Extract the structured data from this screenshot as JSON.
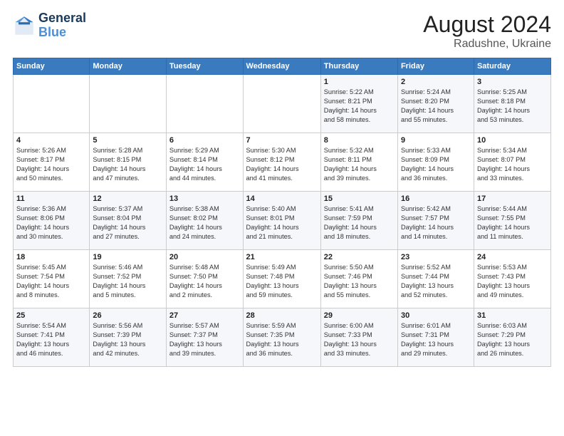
{
  "logo": {
    "line1": "General",
    "line2": "Blue"
  },
  "title": "August 2024",
  "location": "Radushne, Ukraine",
  "days_header": [
    "Sunday",
    "Monday",
    "Tuesday",
    "Wednesday",
    "Thursday",
    "Friday",
    "Saturday"
  ],
  "weeks": [
    [
      {
        "day": "",
        "info": ""
      },
      {
        "day": "",
        "info": ""
      },
      {
        "day": "",
        "info": ""
      },
      {
        "day": "",
        "info": ""
      },
      {
        "day": "1",
        "info": "Sunrise: 5:22 AM\nSunset: 8:21 PM\nDaylight: 14 hours\nand 58 minutes."
      },
      {
        "day": "2",
        "info": "Sunrise: 5:24 AM\nSunset: 8:20 PM\nDaylight: 14 hours\nand 55 minutes."
      },
      {
        "day": "3",
        "info": "Sunrise: 5:25 AM\nSunset: 8:18 PM\nDaylight: 14 hours\nand 53 minutes."
      }
    ],
    [
      {
        "day": "4",
        "info": "Sunrise: 5:26 AM\nSunset: 8:17 PM\nDaylight: 14 hours\nand 50 minutes."
      },
      {
        "day": "5",
        "info": "Sunrise: 5:28 AM\nSunset: 8:15 PM\nDaylight: 14 hours\nand 47 minutes."
      },
      {
        "day": "6",
        "info": "Sunrise: 5:29 AM\nSunset: 8:14 PM\nDaylight: 14 hours\nand 44 minutes."
      },
      {
        "day": "7",
        "info": "Sunrise: 5:30 AM\nSunset: 8:12 PM\nDaylight: 14 hours\nand 41 minutes."
      },
      {
        "day": "8",
        "info": "Sunrise: 5:32 AM\nSunset: 8:11 PM\nDaylight: 14 hours\nand 39 minutes."
      },
      {
        "day": "9",
        "info": "Sunrise: 5:33 AM\nSunset: 8:09 PM\nDaylight: 14 hours\nand 36 minutes."
      },
      {
        "day": "10",
        "info": "Sunrise: 5:34 AM\nSunset: 8:07 PM\nDaylight: 14 hours\nand 33 minutes."
      }
    ],
    [
      {
        "day": "11",
        "info": "Sunrise: 5:36 AM\nSunset: 8:06 PM\nDaylight: 14 hours\nand 30 minutes."
      },
      {
        "day": "12",
        "info": "Sunrise: 5:37 AM\nSunset: 8:04 PM\nDaylight: 14 hours\nand 27 minutes."
      },
      {
        "day": "13",
        "info": "Sunrise: 5:38 AM\nSunset: 8:02 PM\nDaylight: 14 hours\nand 24 minutes."
      },
      {
        "day": "14",
        "info": "Sunrise: 5:40 AM\nSunset: 8:01 PM\nDaylight: 14 hours\nand 21 minutes."
      },
      {
        "day": "15",
        "info": "Sunrise: 5:41 AM\nSunset: 7:59 PM\nDaylight: 14 hours\nand 18 minutes."
      },
      {
        "day": "16",
        "info": "Sunrise: 5:42 AM\nSunset: 7:57 PM\nDaylight: 14 hours\nand 14 minutes."
      },
      {
        "day": "17",
        "info": "Sunrise: 5:44 AM\nSunset: 7:55 PM\nDaylight: 14 hours\nand 11 minutes."
      }
    ],
    [
      {
        "day": "18",
        "info": "Sunrise: 5:45 AM\nSunset: 7:54 PM\nDaylight: 14 hours\nand 8 minutes."
      },
      {
        "day": "19",
        "info": "Sunrise: 5:46 AM\nSunset: 7:52 PM\nDaylight: 14 hours\nand 5 minutes."
      },
      {
        "day": "20",
        "info": "Sunrise: 5:48 AM\nSunset: 7:50 PM\nDaylight: 14 hours\nand 2 minutes."
      },
      {
        "day": "21",
        "info": "Sunrise: 5:49 AM\nSunset: 7:48 PM\nDaylight: 13 hours\nand 59 minutes."
      },
      {
        "day": "22",
        "info": "Sunrise: 5:50 AM\nSunset: 7:46 PM\nDaylight: 13 hours\nand 55 minutes."
      },
      {
        "day": "23",
        "info": "Sunrise: 5:52 AM\nSunset: 7:44 PM\nDaylight: 13 hours\nand 52 minutes."
      },
      {
        "day": "24",
        "info": "Sunrise: 5:53 AM\nSunset: 7:43 PM\nDaylight: 13 hours\nand 49 minutes."
      }
    ],
    [
      {
        "day": "25",
        "info": "Sunrise: 5:54 AM\nSunset: 7:41 PM\nDaylight: 13 hours\nand 46 minutes."
      },
      {
        "day": "26",
        "info": "Sunrise: 5:56 AM\nSunset: 7:39 PM\nDaylight: 13 hours\nand 42 minutes."
      },
      {
        "day": "27",
        "info": "Sunrise: 5:57 AM\nSunset: 7:37 PM\nDaylight: 13 hours\nand 39 minutes."
      },
      {
        "day": "28",
        "info": "Sunrise: 5:59 AM\nSunset: 7:35 PM\nDaylight: 13 hours\nand 36 minutes."
      },
      {
        "day": "29",
        "info": "Sunrise: 6:00 AM\nSunset: 7:33 PM\nDaylight: 13 hours\nand 33 minutes."
      },
      {
        "day": "30",
        "info": "Sunrise: 6:01 AM\nSunset: 7:31 PM\nDaylight: 13 hours\nand 29 minutes."
      },
      {
        "day": "31",
        "info": "Sunrise: 6:03 AM\nSunset: 7:29 PM\nDaylight: 13 hours\nand 26 minutes."
      }
    ]
  ]
}
